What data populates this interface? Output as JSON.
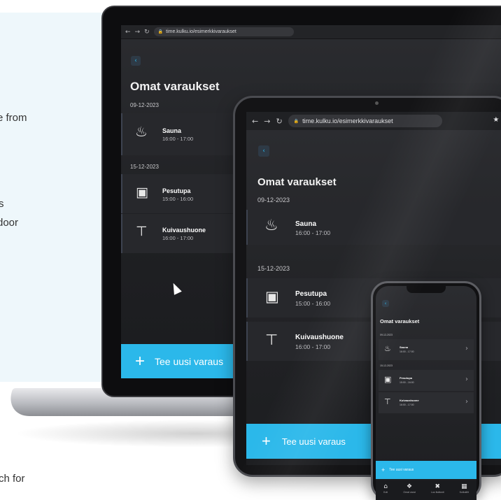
{
  "background_text": {
    "line1": "e from",
    "line2": "s",
    "line3": " door",
    "line4": "ch for"
  },
  "brand_color": "#2bb8ea",
  "laptop": {
    "url": "time.kulku.io/esimerkkivaraukset",
    "title": "Omat varaukset",
    "groups": [
      {
        "date": "09-12-2023",
        "items": [
          {
            "name": "Sauna",
            "time": "16:00 - 17:00",
            "icon": "sauna-icon"
          }
        ]
      },
      {
        "date": "15-12-2023",
        "items": [
          {
            "name": "Pesutupa",
            "time": "15:00 - 16:00",
            "icon": "washing-machine-icon"
          },
          {
            "name": "Kuivaushuone",
            "time": "16:00 - 17:00",
            "icon": "drying-room-icon"
          }
        ]
      }
    ],
    "cta": "Tee uusi varaus"
  },
  "tablet": {
    "url": "time.kulku.io/esimerkkivaraukset",
    "title": "Omat varaukset",
    "groups": [
      {
        "date": "09-12-2023",
        "items": [
          {
            "name": "Sauna",
            "time": "16:00 - 17:00"
          }
        ]
      },
      {
        "date": "15-12-2023",
        "items": [
          {
            "name": "Pesutupa",
            "time": "15:00 - 16:00"
          },
          {
            "name": "Kuivaushuone",
            "time": "16:00 - 17:00"
          }
        ]
      }
    ],
    "cta": "Tee uusi varaus"
  },
  "phone": {
    "title": "Omat varaukset",
    "groups": [
      {
        "date": "09-12-2023",
        "items": [
          {
            "name": "Sauna",
            "time": "16:00 - 17:00"
          }
        ]
      },
      {
        "date": "15-12-2023",
        "items": [
          {
            "name": "Pesutupa",
            "time": "15:00 - 16:00"
          },
          {
            "name": "Kuivaushuone",
            "time": "16:00 - 17:00"
          }
        ]
      }
    ],
    "cta": "Tee uusi varaus",
    "tabs": [
      {
        "label": "Koti",
        "icon": "home-icon"
      },
      {
        "label": "Omat varat",
        "icon": "bookings-icon"
      },
      {
        "label": "Luo lisätunti",
        "icon": "add-icon"
      },
      {
        "label": "Kulkutilit",
        "icon": "building-icon"
      }
    ]
  }
}
